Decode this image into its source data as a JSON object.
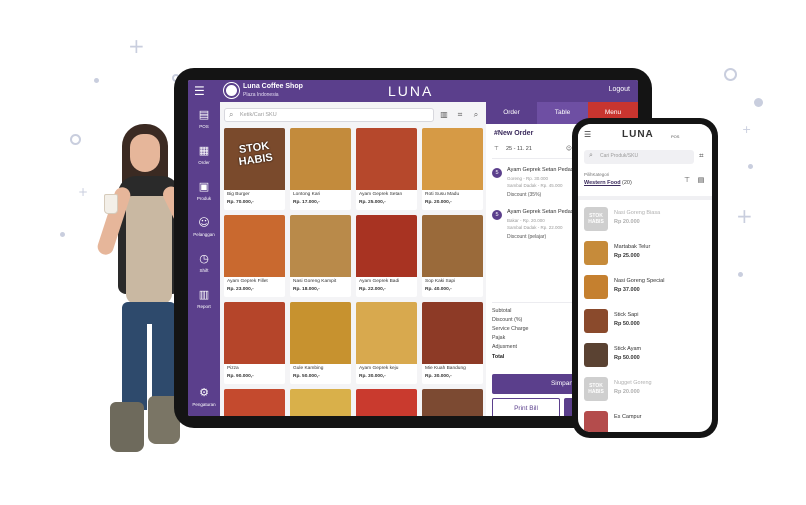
{
  "tablet": {
    "header": {
      "shop_name": "Luna Coffee Shop",
      "shop_location": "Plaza Indonesia",
      "brand": "LUNA",
      "logout": "Logout",
      "bar_color": "#5b3f8c"
    },
    "nav": [
      {
        "label": "POS",
        "icon": "pos-icon"
      },
      {
        "label": "Order",
        "icon": "order-icon"
      },
      {
        "label": "Produk",
        "icon": "product-icon"
      },
      {
        "label": "Pelanggan",
        "icon": "customer-icon"
      },
      {
        "label": "Shift",
        "icon": "shift-icon"
      },
      {
        "label": "Report",
        "icon": "report-icon"
      },
      {
        "label": "Pengaturan",
        "icon": "gear-icon"
      }
    ],
    "search": {
      "placeholder": "Ketik/Cari SKU"
    },
    "products": [
      {
        "name": "Big Burger",
        "price": "Rp. 70.000,-",
        "stok": "STOK HABIS",
        "color": "#7a4a2c"
      },
      {
        "name": "Lontong Kari",
        "price": "Rp. 17.000,-",
        "color": "#c38b3c"
      },
      {
        "name": "Ayam Geprek Setan",
        "price": "Rp. 25.000,-",
        "color": "#b6482c"
      },
      {
        "name": "Roti Susu Madu",
        "price": "Rp. 20.000,-",
        "color": "#d69a45"
      },
      {
        "name": "Ayam Geprek Fillet",
        "price": "Rp. 23.000,-",
        "color": "#c9692f"
      },
      {
        "name": "Nasi Goreng Kampit",
        "price": "Rp. 18.000,-",
        "color": "#b98a4a"
      },
      {
        "name": "Ayam Geprek Badi",
        "price": "Rp. 22.000,-",
        "color": "#a83322"
      },
      {
        "name": "Sop Kaki Sapi",
        "price": "Rp. 40.000,-",
        "color": "#9a6a3a"
      },
      {
        "name": "Pizza",
        "price": "Rp. 90.000,-",
        "color": "#b5452a"
      },
      {
        "name": "Gule Kambing",
        "price": "Rp. 50.000,-",
        "color": "#c7922f"
      },
      {
        "name": "Ayam Geprek keju",
        "price": "Rp. 30.000,-",
        "color": "#d8a94e"
      },
      {
        "name": "Mie Kuah Bandung",
        "price": "Rp. 30.000,-",
        "color": "#8d3a26"
      }
    ],
    "order": {
      "tabs": [
        "Order",
        "Table",
        "Menu"
      ],
      "title": "#New Order",
      "date": "25 - 11. 21",
      "items": [
        {
          "qty": "5",
          "name": "Ayam Geprek Setan Pedas",
          "lines": [
            "Goreng - Rp. 30.000",
            "Sambal Dadak - Rp. 45.000",
            "Discount (35%)"
          ]
        },
        {
          "qty": "5",
          "name": "Ayam Geprek Setan Pedas",
          "lines": [
            "Bakar - Rp. 20.000",
            "Sambal Dadak - Rp. 22.000",
            "Discount (pelajar)"
          ]
        }
      ],
      "summary": [
        "Subtotal",
        "Discount (%)",
        "Service Charge",
        "Pajak",
        "Adjusment",
        "Total"
      ],
      "save_button": "Simpan",
      "print_button": "Print Bill"
    }
  },
  "phone": {
    "brand": "LUNA",
    "brand_sub": "POS",
    "search_placeholder": "Cari Produk/SKU",
    "category_label": "PilihKategori",
    "category": "Western Food",
    "category_count": "(20)",
    "items": [
      {
        "name": "Nasi Goreng Biasa",
        "price": "Rp 20.000",
        "dim": true,
        "stok": "STOK HABIS",
        "color": "#888888"
      },
      {
        "name": "Martabak Telur",
        "price": "Rp 25.000",
        "dim": false,
        "color": "#c68b3a"
      },
      {
        "name": "Nasi Goreng Special",
        "price": "Rp 37.000",
        "dim": false,
        "color": "#c5802f"
      },
      {
        "name": "Stick Sapi",
        "price": "Rp 50.000",
        "dim": false,
        "color": "#8a4a2c"
      },
      {
        "name": "Stick Ayam",
        "price": "Rp 50.000",
        "dim": false,
        "color": "#5a4232"
      },
      {
        "name": "Nugget Goreng",
        "price": "Rp 20.000",
        "dim": true,
        "stok": "STOK HABIS",
        "color": "#888888"
      },
      {
        "name": "Es Campur",
        "price": "",
        "dim": false,
        "color": "#b44c4c"
      }
    ]
  }
}
